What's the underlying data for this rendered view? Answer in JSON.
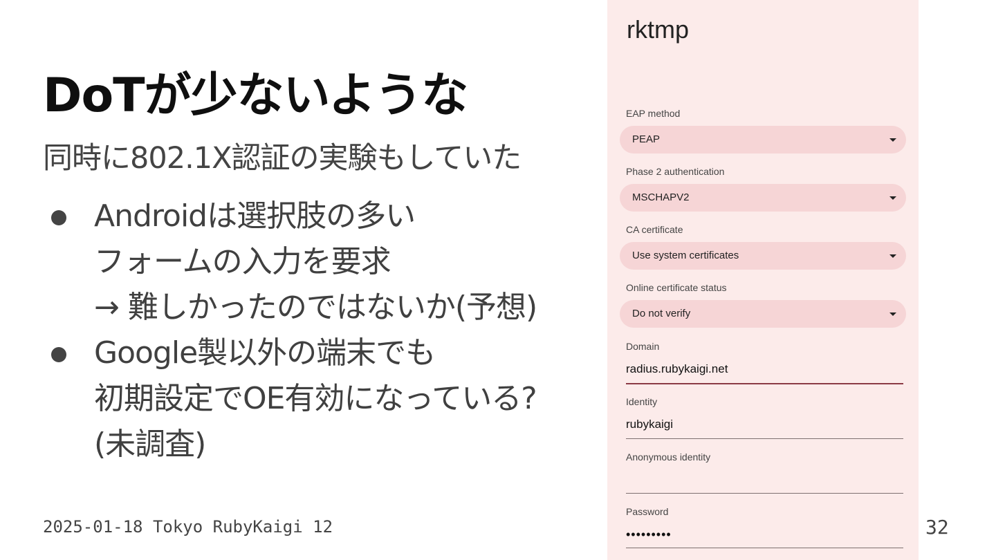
{
  "slide": {
    "title": "DoTが少ないような",
    "subtitle": "同時に802.1X認証の実験もしていた",
    "bullets": [
      [
        "Androidは選択肢の多い",
        "フォームの入力を要求",
        "→ 難しかったのではないか(予想)"
      ],
      [
        "Google製以外の端末でも",
        "初期設定でOE有効になっている?",
        "(未調査)"
      ]
    ],
    "footer": "2025-01-18 Tokyo RubyKaigi 12",
    "page_number": "32"
  },
  "phone": {
    "app_title": "rktmp",
    "eap_method": {
      "label": "EAP method",
      "value": "PEAP"
    },
    "phase2": {
      "label": "Phase 2 authentication",
      "value": "MSCHAPV2"
    },
    "ca_certificate": {
      "label": "CA certificate",
      "value": "Use system certificates"
    },
    "online_cert_status": {
      "label": "Online certificate status",
      "value": "Do not verify"
    },
    "domain": {
      "label": "Domain",
      "value": "radius.rubykaigi.net"
    },
    "identity": {
      "label": "Identity",
      "value": "rubykaigi"
    },
    "anonymous_identity": {
      "label": "Anonymous identity",
      "value": ""
    },
    "password": {
      "label": "Password",
      "value": "•••••••••"
    }
  }
}
